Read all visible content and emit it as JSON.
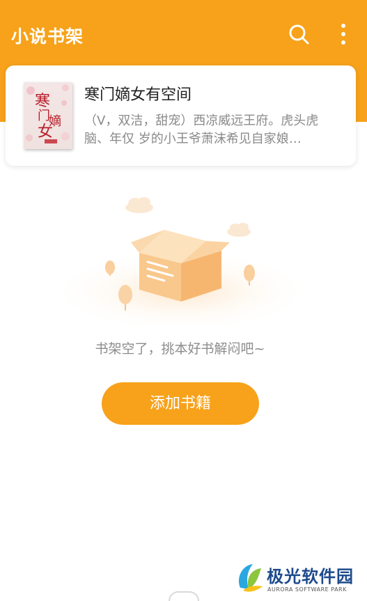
{
  "header": {
    "title": "小说书架",
    "search_icon": "search-icon",
    "more_icon": "more-vertical-icon",
    "background": "#f7a21a"
  },
  "bookshelf": {
    "books": [
      {
        "title": "寒门嫡女有空间",
        "description": "（V，双洁，甜宠）西凉威远王府。虎头虎脑、年仅 岁的小王爷萧沫希见自家娘…",
        "cover_title": "寒门嫡女"
      }
    ]
  },
  "empty_state": {
    "message": "书架空了，挑本好书解闷吧~",
    "illustration": "empty-box-illustration"
  },
  "add_button": {
    "label": "添加书籍"
  },
  "watermark": {
    "name": "极光软件园",
    "sub": "AURORA SOFTWARE PARK"
  },
  "colors": {
    "accent": "#f7a21a",
    "text_secondary": "#8a8a8a"
  }
}
